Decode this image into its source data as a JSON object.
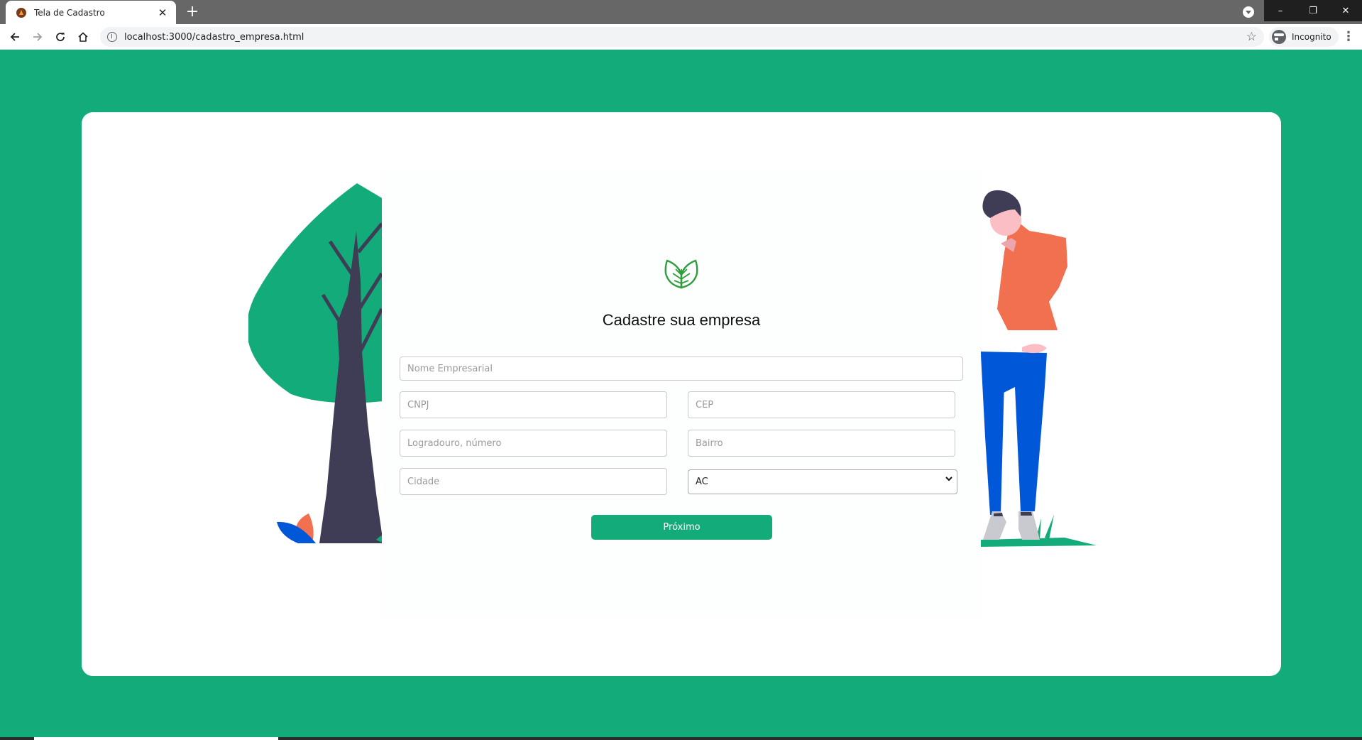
{
  "browser": {
    "tab_title": "Tela de Cadastro",
    "tab_close": "✕",
    "new_tab": "+",
    "url": "localhost:3000/cadastro_empresa.html",
    "incognito_label": "Incognito",
    "window_controls": [
      "–",
      "❐",
      "✕"
    ]
  },
  "page": {
    "background_color": "#14ab7a",
    "heading": "Cadastre sua empresa",
    "logo_icon": "leaves-icon"
  },
  "form": {
    "nome_placeholder": "Nome Empresarial",
    "cnpj_placeholder": "CNPJ",
    "cep_placeholder": "CEP",
    "logradouro_placeholder": "Logradouro, número",
    "bairro_placeholder": "Bairro",
    "cidade_placeholder": "Cidade",
    "estado_selected": "AC",
    "submit_label": "Próximo"
  },
  "colors": {
    "accent": "#14ab7a",
    "shirt": "#f07050",
    "pants": "#0057d8",
    "tree_trunk": "#3f3d56"
  }
}
